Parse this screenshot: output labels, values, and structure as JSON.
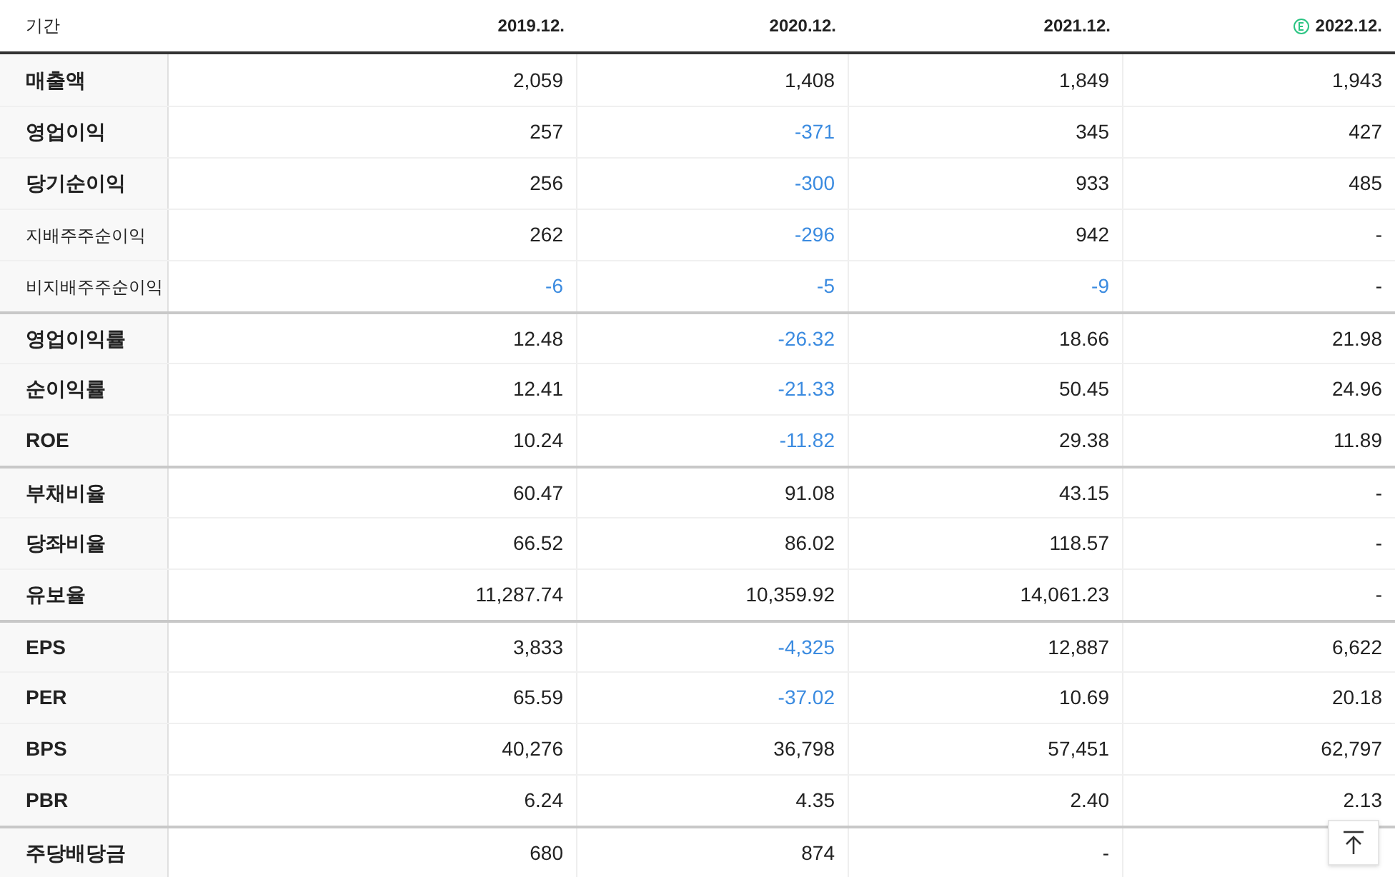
{
  "table": {
    "period_label": "기간",
    "columns": [
      {
        "label": "2019.12.",
        "estimate": false
      },
      {
        "label": "2020.12.",
        "estimate": false
      },
      {
        "label": "2021.12.",
        "estimate": false
      },
      {
        "label": "2022.12.",
        "estimate": true
      }
    ],
    "rows": [
      {
        "label": "매출액",
        "sub": false,
        "group_start": false,
        "cells": [
          {
            "text": "2,059",
            "negative": false
          },
          {
            "text": "1,408",
            "negative": false
          },
          {
            "text": "1,849",
            "negative": false
          },
          {
            "text": "1,943",
            "negative": false
          }
        ]
      },
      {
        "label": "영업이익",
        "sub": false,
        "group_start": false,
        "cells": [
          {
            "text": "257",
            "negative": false
          },
          {
            "text": "-371",
            "negative": true
          },
          {
            "text": "345",
            "negative": false
          },
          {
            "text": "427",
            "negative": false
          }
        ]
      },
      {
        "label": "당기순이익",
        "sub": false,
        "group_start": false,
        "cells": [
          {
            "text": "256",
            "negative": false
          },
          {
            "text": "-300",
            "negative": true
          },
          {
            "text": "933",
            "negative": false
          },
          {
            "text": "485",
            "negative": false
          }
        ]
      },
      {
        "label": "지배주주순이익",
        "sub": true,
        "group_start": false,
        "cells": [
          {
            "text": "262",
            "negative": false
          },
          {
            "text": "-296",
            "negative": true
          },
          {
            "text": "942",
            "negative": false
          },
          {
            "text": "-",
            "negative": false
          }
        ]
      },
      {
        "label": "비지배주주순이익",
        "sub": true,
        "group_start": false,
        "cells": [
          {
            "text": "-6",
            "negative": true
          },
          {
            "text": "-5",
            "negative": true
          },
          {
            "text": "-9",
            "negative": true
          },
          {
            "text": "-",
            "negative": false
          }
        ]
      },
      {
        "label": "영업이익률",
        "sub": false,
        "group_start": true,
        "cells": [
          {
            "text": "12.48",
            "negative": false
          },
          {
            "text": "-26.32",
            "negative": true
          },
          {
            "text": "18.66",
            "negative": false
          },
          {
            "text": "21.98",
            "negative": false
          }
        ]
      },
      {
        "label": "순이익률",
        "sub": false,
        "group_start": false,
        "cells": [
          {
            "text": "12.41",
            "negative": false
          },
          {
            "text": "-21.33",
            "negative": true
          },
          {
            "text": "50.45",
            "negative": false
          },
          {
            "text": "24.96",
            "negative": false
          }
        ]
      },
      {
        "label": "ROE",
        "sub": false,
        "group_start": false,
        "cells": [
          {
            "text": "10.24",
            "negative": false
          },
          {
            "text": "-11.82",
            "negative": true
          },
          {
            "text": "29.38",
            "negative": false
          },
          {
            "text": "11.89",
            "negative": false
          }
        ]
      },
      {
        "label": "부채비율",
        "sub": false,
        "group_start": true,
        "cells": [
          {
            "text": "60.47",
            "negative": false
          },
          {
            "text": "91.08",
            "negative": false
          },
          {
            "text": "43.15",
            "negative": false
          },
          {
            "text": "-",
            "negative": false
          }
        ]
      },
      {
        "label": "당좌비율",
        "sub": false,
        "group_start": false,
        "cells": [
          {
            "text": "66.52",
            "negative": false
          },
          {
            "text": "86.02",
            "negative": false
          },
          {
            "text": "118.57",
            "negative": false
          },
          {
            "text": "-",
            "negative": false
          }
        ]
      },
      {
        "label": "유보율",
        "sub": false,
        "group_start": false,
        "cells": [
          {
            "text": "11,287.74",
            "negative": false
          },
          {
            "text": "10,359.92",
            "negative": false
          },
          {
            "text": "14,061.23",
            "negative": false
          },
          {
            "text": "-",
            "negative": false
          }
        ]
      },
      {
        "label": "EPS",
        "sub": false,
        "group_start": true,
        "cells": [
          {
            "text": "3,833",
            "negative": false
          },
          {
            "text": "-4,325",
            "negative": true
          },
          {
            "text": "12,887",
            "negative": false
          },
          {
            "text": "6,622",
            "negative": false
          }
        ]
      },
      {
        "label": "PER",
        "sub": false,
        "group_start": false,
        "cells": [
          {
            "text": "65.59",
            "negative": false
          },
          {
            "text": "-37.02",
            "negative": true
          },
          {
            "text": "10.69",
            "negative": false
          },
          {
            "text": "20.18",
            "negative": false
          }
        ]
      },
      {
        "label": "BPS",
        "sub": false,
        "group_start": false,
        "cells": [
          {
            "text": "40,276",
            "negative": false
          },
          {
            "text": "36,798",
            "negative": false
          },
          {
            "text": "57,451",
            "negative": false
          },
          {
            "text": "62,797",
            "negative": false
          }
        ]
      },
      {
        "label": "PBR",
        "sub": false,
        "group_start": false,
        "cells": [
          {
            "text": "6.24",
            "negative": false
          },
          {
            "text": "4.35",
            "negative": false
          },
          {
            "text": "2.40",
            "negative": false
          },
          {
            "text": "2.13",
            "negative": false
          }
        ]
      },
      {
        "label": "주당배당금",
        "sub": false,
        "group_start": true,
        "cells": [
          {
            "text": "680",
            "negative": false
          },
          {
            "text": "874",
            "negative": false
          },
          {
            "text": "-",
            "negative": false
          },
          null
        ]
      }
    ]
  }
}
